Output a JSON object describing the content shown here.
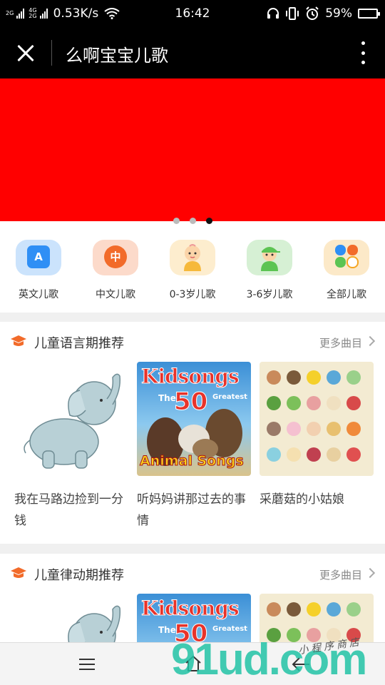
{
  "status_bar": {
    "network_speed": "0.53K/s",
    "net_top": "2G",
    "net_sub_top": "4G",
    "net_sub_bottom": "2G",
    "time": "16:42",
    "battery": "59%",
    "battery_level": 0.59
  },
  "title_bar": {
    "title": "么啊宝宝儿歌"
  },
  "banner": {
    "color": "#ff0000",
    "page_count": 3,
    "active_index": 2
  },
  "categories": [
    {
      "label": "英文儿歌",
      "icon": "letter-a-icon",
      "glyph": "A",
      "color": "#2f8ff5"
    },
    {
      "label": "中文儿歌",
      "icon": "chinese-music-icon",
      "glyph": "中",
      "color": "#f26b2a"
    },
    {
      "label": "0-3岁儿歌",
      "icon": "baby-icon",
      "glyph": "",
      "color": "#f6b93b"
    },
    {
      "label": "3-6岁儿歌",
      "icon": "child-icon",
      "glyph": "",
      "color": "#5cc453"
    },
    {
      "label": "全部儿歌",
      "icon": "all-songs-icon",
      "glyph": "",
      "color": "#f5a623"
    }
  ],
  "sections": [
    {
      "title": "儿童语言期推荐",
      "more": "更多曲目",
      "cards": [
        {
          "name": "我在马路边捡到一分钱",
          "art": "elephant-illustration"
        },
        {
          "name": "听妈妈讲那过去的事情",
          "art": "kidsongs-cover",
          "cover_text": [
            "Kidsongs",
            "The",
            "50",
            "Greatest",
            "Animal Songs"
          ]
        },
        {
          "name": "采蘑菇的小姑娘",
          "art": "vegetable-chart"
        }
      ]
    },
    {
      "title": "儿童律动期推荐",
      "more": "更多曲目",
      "cards": [
        {
          "name": "",
          "art": "elephant-illustration"
        },
        {
          "name": "",
          "art": "kidsongs-cover",
          "cover_text": [
            "Kidsongs",
            "The",
            "50",
            "Greatest",
            ""
          ]
        },
        {
          "name": "",
          "art": "vegetable-chart"
        }
      ]
    }
  ],
  "watermark": {
    "brand": "91ud.com",
    "tagline": "小程序商店"
  },
  "colors": {
    "accent_orange": "#f26b2a"
  }
}
